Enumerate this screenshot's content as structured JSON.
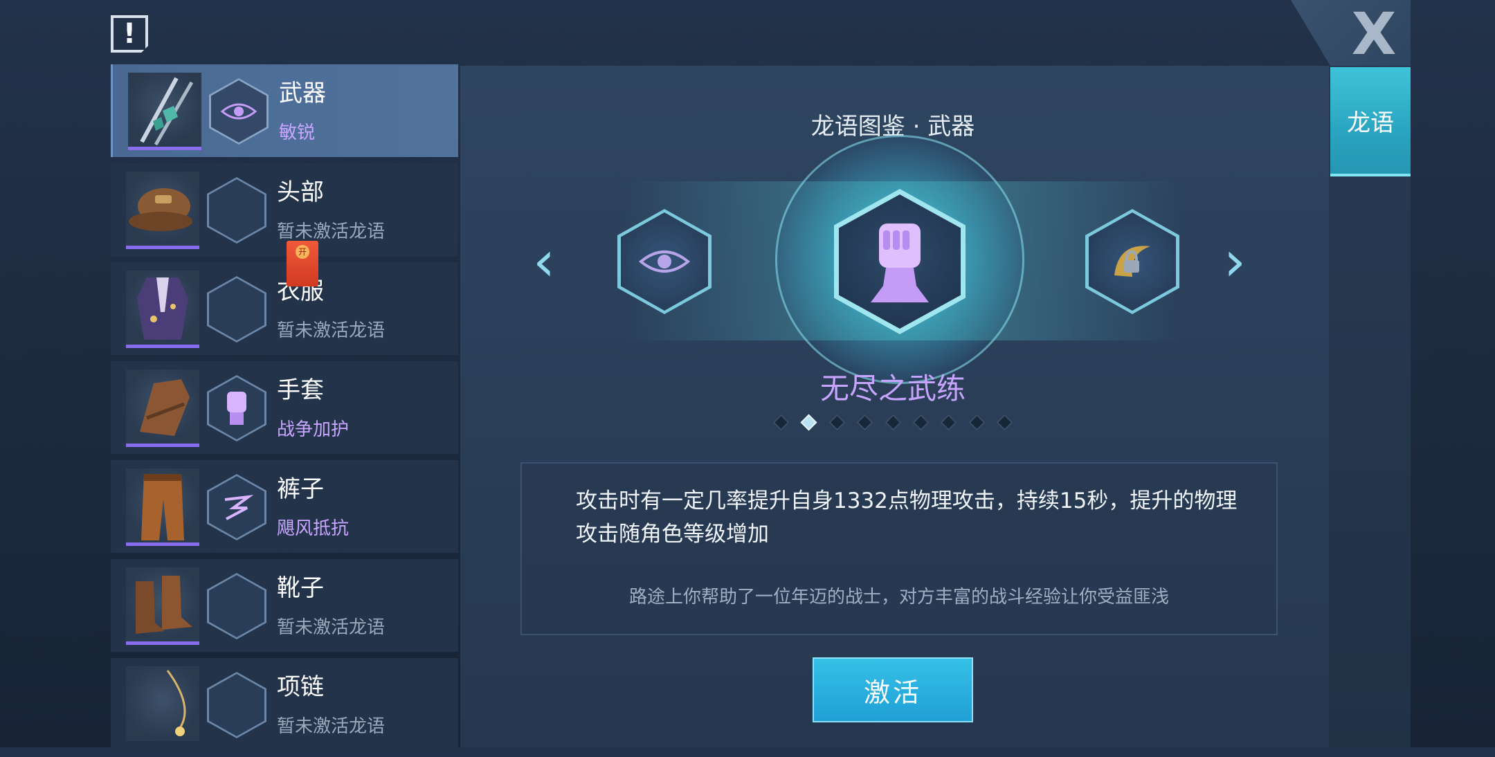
{
  "header": {
    "alert_glyph": "!",
    "close_glyph": "X"
  },
  "tabs": {
    "active_label": "龙语"
  },
  "equipment": [
    {
      "name": "武器",
      "sub": "敏锐",
      "active": true,
      "selected": true
    },
    {
      "name": "头部",
      "sub": "暂未激活龙语",
      "active": false,
      "selected": false
    },
    {
      "name": "衣服",
      "sub": "暂未激活龙语",
      "active": false,
      "selected": false
    },
    {
      "name": "手套",
      "sub": "战争加护",
      "active": true,
      "selected": false
    },
    {
      "name": "裤子",
      "sub": "飓风抵抗",
      "active": true,
      "selected": false
    },
    {
      "name": "靴子",
      "sub": "暂未激活龙语",
      "active": false,
      "selected": false
    },
    {
      "name": "项链",
      "sub": "暂未激活龙语",
      "active": false,
      "selected": false
    }
  ],
  "badge": {
    "label": "开"
  },
  "banner": {
    "title": "龙语图鉴 · 武器",
    "talent_name": "无尽之武练",
    "page_count": 9,
    "current_page": 2
  },
  "description": {
    "main": "攻击时有一定几率提升自身1332点物理攻击，持续15秒，提升的物理攻击随角色等级增加",
    "flavor": "路途上你帮助了一位年迈的战士，对方丰富的战斗经验让你受益匪浅"
  },
  "actions": {
    "activate_label": "激活"
  },
  "colors": {
    "accent": "#2aa5c1",
    "active_text": "#c9a6ff",
    "button": "#1f9fd6"
  }
}
